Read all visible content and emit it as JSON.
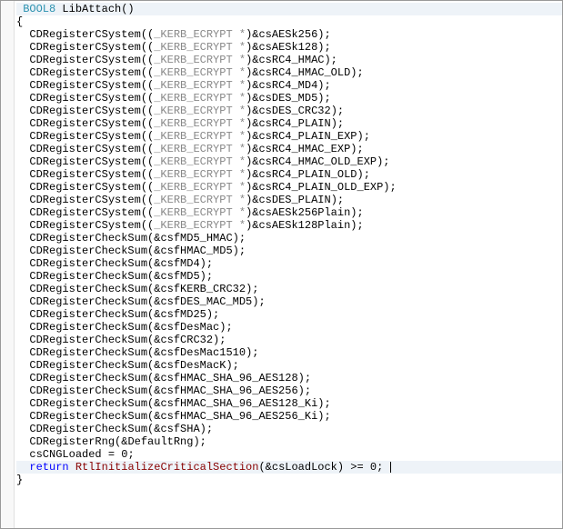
{
  "function_signature": {
    "return_type": "BOOL8",
    "name": "LibAttach",
    "params": "()"
  },
  "body": {
    "register_csystem": {
      "fn": "CDRegisterCSystem",
      "cast": "_KERB_ECRYPT *",
      "args": [
        "csAESk256",
        "csAESk128",
        "csRC4_HMAC",
        "csRC4_HMAC_OLD",
        "csRC4_MD4",
        "csDES_MD5",
        "csDES_CRC32",
        "csRC4_PLAIN",
        "csRC4_PLAIN_EXP",
        "csRC4_HMAC_EXP",
        "csRC4_HMAC_OLD_EXP",
        "csRC4_PLAIN_OLD",
        "csRC4_PLAIN_OLD_EXP",
        "csDES_PLAIN",
        "csAESk256Plain",
        "csAESk128Plain"
      ]
    },
    "register_checksum": {
      "fn": "CDRegisterCheckSum",
      "args": [
        "csfMD5_HMAC",
        "csfHMAC_MD5",
        "csfMD4",
        "csfMD5",
        "csfKERB_CRC32",
        "csfDES_MAC_MD5",
        "csfMD25",
        "csfDesMac",
        "csfCRC32",
        "csfDesMac1510",
        "csfDesMacK",
        "csfHMAC_SHA_96_AES128",
        "csfHMAC_SHA_96_AES256",
        "csfHMAC_SHA_96_AES128_Ki",
        "csfHMAC_SHA_96_AES256_Ki",
        "csfSHA"
      ]
    },
    "register_rng": {
      "fn": "CDRegisterRng",
      "arg": "DefaultRng"
    },
    "assign": {
      "lhs": "csCNGLoaded",
      "rhs": "0"
    },
    "return_stmt": {
      "kw": "return",
      "fn": "RtlInitializeCriticalSection",
      "arg": "csLoadLock",
      "cmp": ">=",
      "rhs": "0"
    }
  }
}
